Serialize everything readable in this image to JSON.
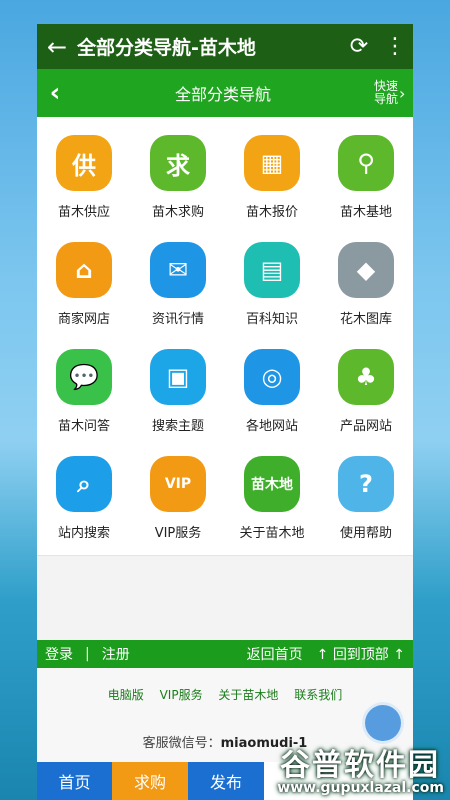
{
  "appbar": {
    "title": "全部分类导航-苗木地",
    "back_icon": "←",
    "refresh_icon": "⟳",
    "menu_icon": "⋮"
  },
  "subheader": {
    "title": "全部分类导航",
    "back_icon": "‹",
    "quick_nav": "快速导航",
    "quick_arrow": "›"
  },
  "grid": [
    {
      "label": "苗木供应",
      "glyph": "供",
      "color": "#f3a414",
      "icon": "supply-icon"
    },
    {
      "label": "苗木求购",
      "glyph": "求",
      "color": "#5db82b",
      "icon": "purchase-icon"
    },
    {
      "label": "苗木报价",
      "glyph": "▦",
      "color": "#f3a414",
      "icon": "price-list-icon"
    },
    {
      "label": "苗木基地",
      "glyph": "⚲",
      "color": "#5db82b",
      "icon": "map-pin-icon"
    },
    {
      "label": "商家网店",
      "glyph": "⌂",
      "color": "#f39a14",
      "icon": "shop-icon"
    },
    {
      "label": "资讯行情",
      "glyph": "✉",
      "color": "#1f95e6",
      "icon": "news-icon"
    },
    {
      "label": "百科知识",
      "glyph": "▤",
      "color": "#1fbeb3",
      "icon": "book-icon"
    },
    {
      "label": "花木图库",
      "glyph": "◆",
      "color": "#8a9aa0",
      "icon": "gallery-icon"
    },
    {
      "label": "苗木问答",
      "glyph": "💬",
      "color": "#3ac14a",
      "icon": "chat-icon"
    },
    {
      "label": "搜索主题",
      "glyph": "▣",
      "color": "#1ca6e8",
      "icon": "box-icon"
    },
    {
      "label": "各地网站",
      "glyph": "◎",
      "color": "#1f95e6",
      "icon": "balloon-icon"
    },
    {
      "label": "产品网站",
      "glyph": "♣",
      "color": "#5db82b",
      "icon": "tree-icon"
    },
    {
      "label": "站内搜索",
      "glyph": "⌕",
      "color": "#1c9ee8",
      "icon": "search-icon"
    },
    {
      "label": "VIP服务",
      "glyph": "VIP",
      "color": "#f39a14",
      "icon": "vip-icon"
    },
    {
      "label": "关于苗木地",
      "glyph": "苗木地",
      "color": "#3fae2a",
      "icon": "logo-icon"
    },
    {
      "label": "使用帮助",
      "glyph": "?",
      "color": "#4fb4e8",
      "icon": "help-icon"
    }
  ],
  "footer": {
    "login": "登录",
    "sep": "|",
    "register": "注册",
    "home": "返回首页",
    "top": "回到顶部",
    "up_arrow": "↑",
    "links": [
      "电脑版",
      "VIP服务",
      "关于苗木地",
      "联系我们"
    ],
    "wechat_label": "客服微信号：",
    "wechat_id": "miaomudi-1"
  },
  "bottom_nav": [
    {
      "label": "首页",
      "color": "#1b6fd1"
    },
    {
      "label": "求购",
      "color": "#f39a14"
    },
    {
      "label": "发布",
      "color": "#1b6fd1"
    }
  ],
  "watermark": {
    "brand": "谷普软件园",
    "url": "www.gupuxlazal.com"
  }
}
